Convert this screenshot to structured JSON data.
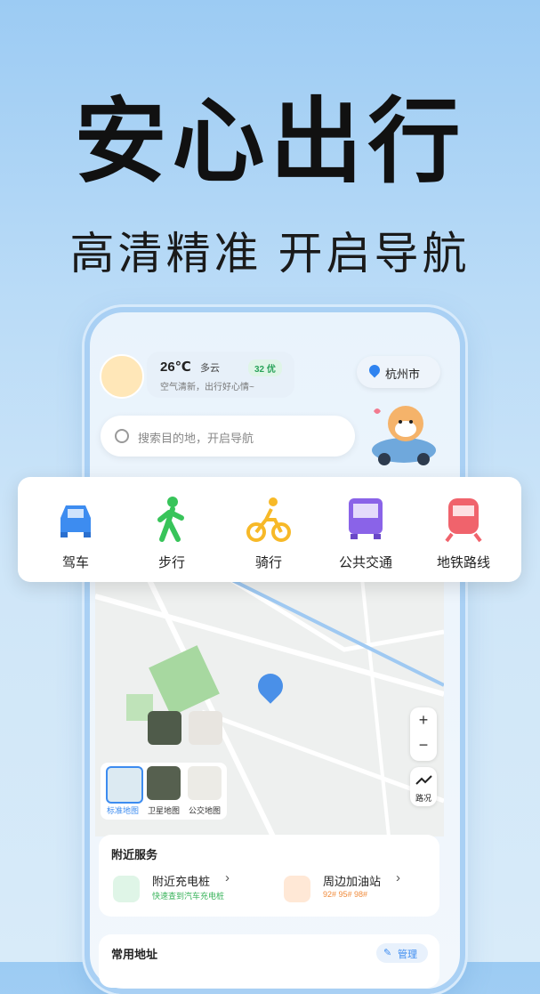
{
  "headline": {
    "title": "安心出行",
    "subtitle": "高清精准 开启导航"
  },
  "weather": {
    "temperature": "26℃",
    "condition": "多云",
    "aqi": "32 优",
    "air_note": "空气清新，出行好心情~"
  },
  "location": {
    "city": "杭州市"
  },
  "search": {
    "placeholder": "搜索目的地，开启导航"
  },
  "modes": [
    {
      "label": "驾车",
      "color": "#3d8cf0"
    },
    {
      "label": "步行",
      "color": "#38c45a"
    },
    {
      "label": "骑行",
      "color": "#f7b928"
    },
    {
      "label": "公共交通",
      "color": "#8a63e8"
    },
    {
      "label": "地铁路线",
      "color": "#f0636c"
    }
  ],
  "map_controls": {
    "zoom_in": "+",
    "zoom_out": "−",
    "traffic": "路况"
  },
  "map_layers": [
    {
      "label": "标准地图"
    },
    {
      "label": "卫星地图"
    },
    {
      "label": "公交地图"
    }
  ],
  "services": {
    "title": "附近服务",
    "items": [
      {
        "label": "附近充电桩",
        "sub": "快速查到汽车充电桩",
        "arrow": "›"
      },
      {
        "label": "周边加油站",
        "sub": "92# 95# 98#",
        "arrow": "›"
      }
    ]
  },
  "common": {
    "title": "常用地址",
    "manage": "管理"
  }
}
